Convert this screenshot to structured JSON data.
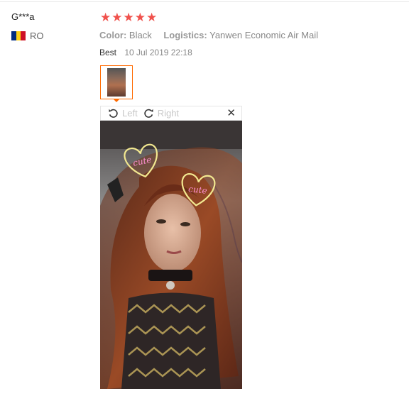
{
  "review": {
    "user_name": "G***a",
    "country": {
      "code": "RO",
      "flag_colors": [
        "#002b7f",
        "#fcd116",
        "#ce1126"
      ]
    },
    "rating": {
      "stars": 5,
      "max": 5,
      "star_glyph": "★",
      "star_color": "#f0514c"
    },
    "attributes": [
      {
        "key": "Color:",
        "value": "Black"
      },
      {
        "key": "Logistics:",
        "value": "Yanwen Economic Air Mail"
      }
    ],
    "label": "Best",
    "date": "10 Jul 2019 22:18"
  },
  "viewer": {
    "rotate_left_label": "Left",
    "rotate_right_label": "Right",
    "close_glyph": "✕",
    "accent_color": "#ff6a00",
    "photo": {
      "sticker_text": "cute"
    }
  }
}
